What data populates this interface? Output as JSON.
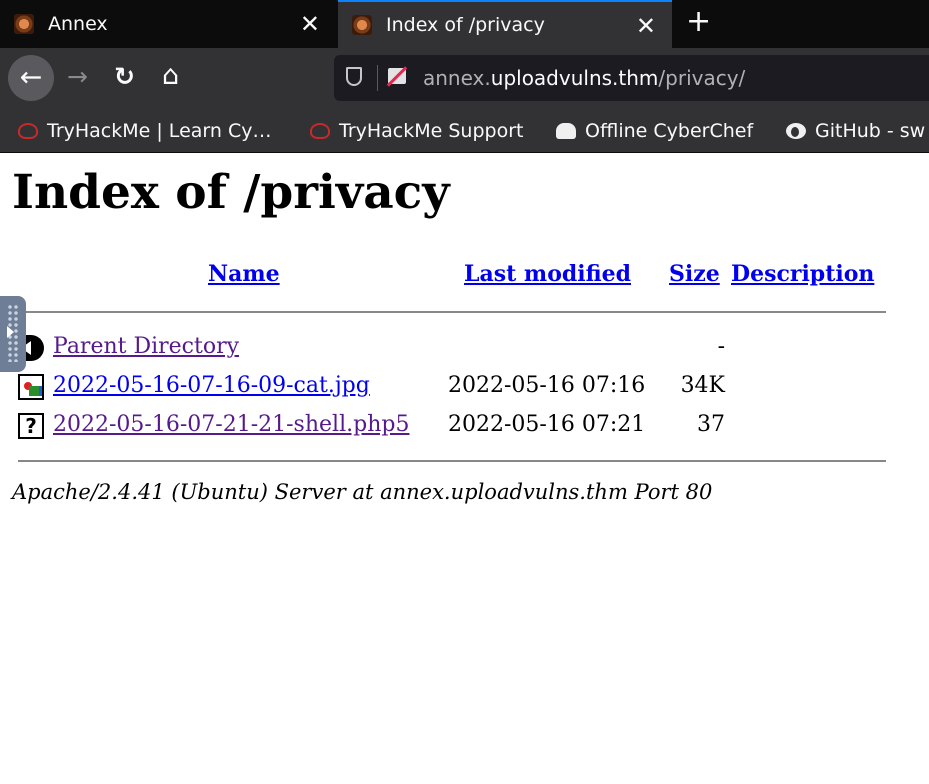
{
  "tabs": [
    {
      "title": "Annex",
      "close": "✕"
    },
    {
      "title": "Index of /privacy",
      "close": "✕"
    }
  ],
  "new_tab_label": "+",
  "nav": {
    "back_icon": "←",
    "forward_icon": "→",
    "reload_icon": "↻",
    "home_icon": "⌂"
  },
  "url": {
    "prefix": "annex.",
    "host": "uploadvulns.thm",
    "path": "/privacy/"
  },
  "bookmarks": [
    {
      "label": "TryHackMe | Learn Cy…",
      "icon": "tryhackme-icon"
    },
    {
      "label": "TryHackMe Support",
      "icon": "tryhackme-icon"
    },
    {
      "label": "Offline CyberChef",
      "icon": "cyberchef-icon"
    },
    {
      "label": "GitHub - sw",
      "icon": "github-icon"
    }
  ],
  "page": {
    "heading": "Index of /privacy",
    "columns": {
      "name": "Name",
      "last_modified": "Last modified",
      "size": "Size",
      "description": "Description"
    },
    "rows": [
      {
        "name": "Parent Directory",
        "date": "",
        "size": "-",
        "icon": "back-icon"
      },
      {
        "name": "2022-05-16-07-16-09-cat.jpg",
        "date": "2022-05-16 07:16",
        "size": "34K",
        "icon": "image-file-icon"
      },
      {
        "name": "2022-05-16-07-21-21-shell.php5",
        "date": "2022-05-16 07:21",
        "size": "37",
        "icon": "unknown-file-icon"
      }
    ],
    "footer": "Apache/2.4.41 (Ubuntu) Server at annex.uploadvulns.thm Port 80"
  }
}
